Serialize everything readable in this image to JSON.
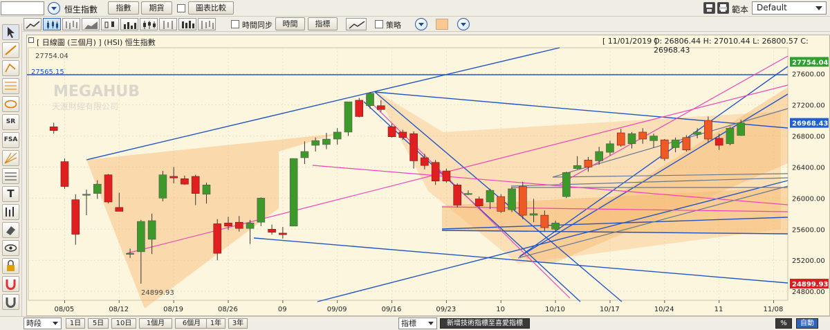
{
  "toolbar": {
    "symbol_value": "",
    "instrument_name": "恒生指數",
    "index_button": "指數",
    "futures_button": "期貨",
    "compare_label": "圖表比較",
    "template_label": "範本",
    "template_value": "Default"
  },
  "toolbar2": {
    "time_sync_label": "時間同步",
    "time_button": "時間",
    "indicator_button": "指標",
    "strategy_label": "策略"
  },
  "left_tools": [
    "select",
    "line",
    "parallel",
    "fib",
    "ellipse",
    "SR",
    "FSA",
    "gann",
    "ruler",
    "text",
    "bars",
    "eraser",
    "visibility",
    "lock",
    "magnet",
    "delete"
  ],
  "chart": {
    "header_left": "[ 日線圖 (三個月) ]  (HSI)  恒生指數",
    "header_date": "[ 11/01/2019 ]",
    "header_ohlc": "O: 26806.44  H: 27010.44  L: 26800.57  C: 26968.43",
    "watermark": "MEGAHUB",
    "watermark_sub": "天滙財經有限公司",
    "high_label": "27754.04",
    "line_label": "27565.15",
    "low_label": "24899.93",
    "last_price_tag": "26968.43",
    "high_tag": "27754.04",
    "low_tag": "24899.93",
    "colors": {
      "up": "#3d9a2a",
      "down": "#e02020",
      "down_orange": "#ee5a24",
      "pitchfork": "#2255c4",
      "pink": "#ee44bb",
      "fill": "#f6b76e",
      "tag_green": "#2ea02e",
      "tag_blue": "#1f5fd0",
      "tag_red": "#d42020"
    }
  },
  "chart_data": {
    "type": "candlestick",
    "title": "[ 日線圖 (三個月) ] (HSI) 恒生指數",
    "ylim": [
      24650,
      27900
    ],
    "y_ticks": [
      24800,
      25200,
      25600,
      26000,
      26400,
      26800,
      27200,
      27600
    ],
    "y_tick_labels": [
      "24800.00",
      "25200.00",
      "25600.00",
      "26000.00",
      "26400.00",
      "26800.00",
      "27200.00",
      "27600.00"
    ],
    "x_tick_labels": [
      "08/05",
      "08/12",
      "08/19",
      "08/26",
      "09",
      "09/09",
      "09/16",
      "09/23",
      "10",
      "10/10",
      "10/17",
      "10/24",
      "11",
      "11/08"
    ],
    "x_tick_index": [
      1,
      6,
      11,
      16,
      21,
      26,
      31,
      36,
      41,
      46,
      51,
      56,
      61,
      66
    ],
    "candles": [
      {
        "o": 26918,
        "h": 26970,
        "l": 26830,
        "c": 26870
      },
      {
        "o": 26470,
        "h": 26510,
        "l": 26120,
        "c": 26150
      },
      {
        "o": 25980,
        "h": 26050,
        "l": 25400,
        "c": 25535
      },
      {
        "o": 26050,
        "h": 26110,
        "l": 25780,
        "c": 26050
      },
      {
        "o": 26060,
        "h": 26230,
        "l": 25990,
        "c": 26180
      },
      {
        "o": 26300,
        "h": 26310,
        "l": 25930,
        "c": 25950
      },
      {
        "o": 25880,
        "h": 26070,
        "l": 25830,
        "c": 25830
      },
      {
        "o": 25290,
        "h": 25350,
        "l": 25230,
        "c": 25290
      },
      {
        "o": 25310,
        "h": 25720,
        "l": 24900,
        "c": 25700
      },
      {
        "o": 25470,
        "h": 25800,
        "l": 25280,
        "c": 25710
      },
      {
        "o": 26000,
        "h": 26350,
        "l": 25960,
        "c": 26300
      },
      {
        "o": 26280,
        "h": 26400,
        "l": 26190,
        "c": 26260
      },
      {
        "o": 26250,
        "h": 26290,
        "l": 26170,
        "c": 26180
      },
      {
        "o": 26280,
        "h": 26300,
        "l": 25910,
        "c": 26060
      },
      {
        "o": 26050,
        "h": 26200,
        "l": 25930,
        "c": 26170
      },
      {
        "o": 25670,
        "h": 25730,
        "l": 25200,
        "c": 25290
      },
      {
        "o": 25680,
        "h": 25760,
        "l": 25590,
        "c": 25640
      },
      {
        "o": 25690,
        "h": 25770,
        "l": 25570,
        "c": 25610
      },
      {
        "o": 25610,
        "h": 25720,
        "l": 25410,
        "c": 25680
      },
      {
        "o": 25690,
        "h": 26010,
        "l": 25640,
        "c": 26000
      },
      {
        "o": 25600,
        "h": 25660,
        "l": 25530,
        "c": 25560
      },
      {
        "o": 25550,
        "h": 25630,
        "l": 25480,
        "c": 25530
      },
      {
        "o": 25640,
        "h": 26510,
        "l": 25640,
        "c": 26510
      },
      {
        "o": 26520,
        "h": 26730,
        "l": 26440,
        "c": 26600
      },
      {
        "o": 26680,
        "h": 26780,
        "l": 26600,
        "c": 26740
      },
      {
        "o": 26690,
        "h": 26840,
        "l": 26630,
        "c": 26760
      },
      {
        "o": 26760,
        "h": 26900,
        "l": 26690,
        "c": 26850
      },
      {
        "o": 26850,
        "h": 27240,
        "l": 26800,
        "c": 27240
      },
      {
        "o": 27260,
        "h": 27290,
        "l": 27040,
        "c": 27050
      },
      {
        "o": 27190,
        "h": 27360,
        "l": 27150,
        "c": 27350
      },
      {
        "o": 27190,
        "h": 27260,
        "l": 27110,
        "c": 27140
      },
      {
        "o": 26920,
        "h": 26960,
        "l": 26780,
        "c": 26790
      },
      {
        "o": 26850,
        "h": 26880,
        "l": 26750,
        "c": 26780
      },
      {
        "o": 26830,
        "h": 26860,
        "l": 26380,
        "c": 26480
      },
      {
        "o": 26520,
        "h": 26570,
        "l": 26370,
        "c": 26420
      },
      {
        "o": 26460,
        "h": 26490,
        "l": 26170,
        "c": 26220
      },
      {
        "o": 26350,
        "h": 26380,
        "l": 26200,
        "c": 26220
      },
      {
        "o": 26170,
        "h": 26190,
        "l": 25880,
        "c": 25910
      },
      {
        "o": 26060,
        "h": 26100,
        "l": 26040,
        "c": 26060
      },
      {
        "o": 25990,
        "h": 26020,
        "l": 25880,
        "c": 25900
      },
      {
        "o": 25950,
        "h": 26120,
        "l": 25860,
        "c": 26100
      },
      {
        "o": 26020,
        "h": 26050,
        "l": 25810,
        "c": 25830
      },
      {
        "o": 25850,
        "h": 26140,
        "l": 25820,
        "c": 26120
      },
      {
        "o": 26150,
        "h": 26210,
        "l": 25730,
        "c": 25780
      },
      {
        "o": 25780,
        "h": 25990,
        "l": 25690,
        "c": 25800
      },
      {
        "o": 25780,
        "h": 25840,
        "l": 25580,
        "c": 25620
      },
      {
        "o": 25600,
        "h": 25710,
        "l": 25560,
        "c": 25680
      },
      {
        "o": 26020,
        "h": 26340,
        "l": 26000,
        "c": 26330
      },
      {
        "o": 26380,
        "h": 26540,
        "l": 26370,
        "c": 26420
      },
      {
        "o": 26490,
        "h": 26530,
        "l": 26340,
        "c": 26400
      },
      {
        "o": 26480,
        "h": 26660,
        "l": 26430,
        "c": 26600
      },
      {
        "o": 26590,
        "h": 26740,
        "l": 26550,
        "c": 26700
      },
      {
        "o": 26840,
        "h": 26890,
        "l": 26660,
        "c": 26680
      },
      {
        "o": 26700,
        "h": 26850,
        "l": 26640,
        "c": 26830
      },
      {
        "o": 26850,
        "h": 26900,
        "l": 26700,
        "c": 26760
      },
      {
        "o": 26740,
        "h": 26830,
        "l": 26650,
        "c": 26800
      },
      {
        "o": 26750,
        "h": 26760,
        "l": 26480,
        "c": 26510
      },
      {
        "o": 26650,
        "h": 26780,
        "l": 26590,
        "c": 26750
      },
      {
        "o": 26780,
        "h": 26810,
        "l": 26600,
        "c": 26620
      },
      {
        "o": 26820,
        "h": 26900,
        "l": 26770,
        "c": 26850
      },
      {
        "o": 27000,
        "h": 27050,
        "l": 26720,
        "c": 26760
      },
      {
        "o": 26770,
        "h": 26830,
        "l": 26620,
        "c": 26680
      },
      {
        "o": 26700,
        "h": 26920,
        "l": 26680,
        "c": 26900
      },
      {
        "o": 26806,
        "h": 27010,
        "l": 26801,
        "c": 26968
      }
    ]
  },
  "bottom": {
    "period_label": "時段",
    "range_buttons": [
      "1日",
      "5日",
      "10日",
      "1個月",
      "6個月",
      "1年",
      "3年"
    ],
    "indicator_select": "指標",
    "add_indicator_button": "新增技術指標至喜愛指標",
    "percent_button": "%",
    "auto_button": "自動"
  }
}
